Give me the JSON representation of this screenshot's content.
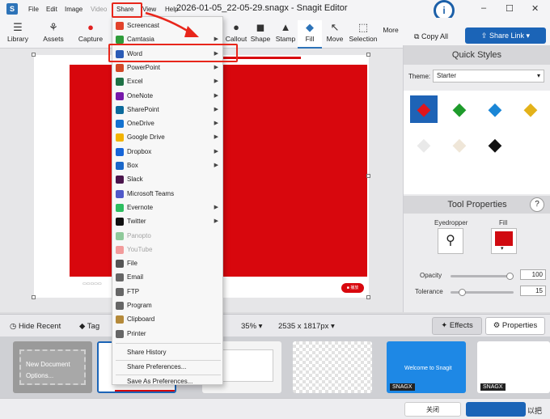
{
  "app": {
    "logo": "S",
    "window_title": "2026-01-05_22-05-29.snagx - Snagit Editor",
    "status_badge": "i"
  },
  "menu": {
    "file": "File",
    "edit": "Edit",
    "image": "Image",
    "video": "Video",
    "share": "Share",
    "view": "View",
    "help": "Help"
  },
  "window_controls": {
    "minimize": "–",
    "maximize": "☐",
    "close": "✕"
  },
  "toolbar": {
    "library": "Library",
    "assets": "Assets",
    "capture": "Capture",
    "callout": "Callout",
    "shape": "Shape",
    "stamp": "Stamp",
    "fill": "Fill",
    "move": "Move",
    "selection": "Selection",
    "more": "More",
    "copy_all": "Copy All",
    "share_link": "Share Link"
  },
  "share_menu": {
    "items": [
      {
        "label": "Screencast",
        "icon": "screencast-icon",
        "color": "#e2432b",
        "disabled": false,
        "submenu": false
      },
      {
        "label": "Camtasia",
        "icon": "camtasia-icon",
        "color": "#2f9c3a",
        "disabled": false,
        "submenu": true
      },
      {
        "label": "Word",
        "icon": "word-icon",
        "color": "#2b5cb6",
        "disabled": false,
        "submenu": true
      },
      {
        "label": "PowerPoint",
        "icon": "powerpoint-icon",
        "color": "#d24726",
        "disabled": false,
        "submenu": true
      },
      {
        "label": "Excel",
        "icon": "excel-icon",
        "color": "#1e7145",
        "disabled": false,
        "submenu": true
      },
      {
        "label": "OneNote",
        "icon": "onenote-icon",
        "color": "#7719aa",
        "disabled": false,
        "submenu": true
      },
      {
        "label": "SharePoint",
        "icon": "sharepoint-icon",
        "color": "#0b6a9b",
        "disabled": false,
        "submenu": true
      },
      {
        "label": "OneDrive",
        "icon": "onedrive-icon",
        "color": "#1472d0",
        "disabled": false,
        "submenu": true
      },
      {
        "label": "Google Drive",
        "icon": "google-drive-icon",
        "color": "#f2b300",
        "disabled": false,
        "submenu": true
      },
      {
        "label": "Dropbox",
        "icon": "dropbox-icon",
        "color": "#1665d8",
        "disabled": false,
        "submenu": true
      },
      {
        "label": "Box",
        "icon": "box-icon",
        "color": "#1b67c9",
        "disabled": false,
        "submenu": true
      },
      {
        "label": "Slack",
        "icon": "slack-icon",
        "color": "#4a154b",
        "disabled": false,
        "submenu": false
      },
      {
        "label": "Microsoft Teams",
        "icon": "teams-icon",
        "color": "#5059c9",
        "disabled": false,
        "submenu": false
      },
      {
        "label": "Evernote",
        "icon": "evernote-icon",
        "color": "#2dbe60",
        "disabled": false,
        "submenu": true
      },
      {
        "label": "Twitter",
        "icon": "twitter-icon",
        "color": "#111111",
        "disabled": false,
        "submenu": true
      },
      {
        "label": "Panopto",
        "icon": "panopto-icon",
        "color": "#8fc99a",
        "disabled": true,
        "submenu": false
      },
      {
        "label": "YouTube",
        "icon": "youtube-icon",
        "color": "#f29b9b",
        "disabled": true,
        "submenu": false
      },
      {
        "label": "File",
        "icon": "file-icon",
        "color": "#555555",
        "disabled": false,
        "submenu": false
      },
      {
        "label": "Email",
        "icon": "email-icon",
        "color": "#666666",
        "disabled": false,
        "submenu": false
      },
      {
        "label": "FTP",
        "icon": "ftp-icon",
        "color": "#666666",
        "disabled": false,
        "submenu": false
      },
      {
        "label": "Program",
        "icon": "program-icon",
        "color": "#666666",
        "disabled": false,
        "submenu": false
      },
      {
        "label": "Clipboard",
        "icon": "clipboard-icon",
        "color": "#b58a3a",
        "disabled": false,
        "submenu": false
      },
      {
        "label": "Printer",
        "icon": "printer-icon",
        "color": "#666666",
        "disabled": false,
        "submenu": false
      }
    ],
    "history": "Share History",
    "preferences": "Share Preferences...",
    "save_as_preferences": "Save As Preferences..."
  },
  "panel": {
    "quick_styles": "Quick Styles",
    "theme_label": "Theme:",
    "theme_value": "Starter",
    "tool_properties": "Tool Properties",
    "help": "?",
    "eyedropper": "Eyedropper",
    "fill": "Fill",
    "fill_color": "#d00a10",
    "opacity_label": "Opacity",
    "opacity_value": "100",
    "opacity_level": 1.0,
    "tolerance_label": "Tolerance",
    "tolerance_value": "15",
    "tolerance_level": 0.15,
    "swatch_colors": [
      "#e0151b",
      "#1e9b2b",
      "#1a86d6",
      "#e3b21a",
      "#e9e9e9",
      "#efe6d8",
      "#111111"
    ]
  },
  "bottom": {
    "hide_recent": "Hide Recent",
    "tag": "Tag",
    "zoom": "35%",
    "dimensions": "2535 x 1817px",
    "effects": "Effects",
    "properties": "Properties"
  },
  "tray": {
    "new_document": "New Document",
    "options": "Options...",
    "welcome": "Welcome to Snagit",
    "snagx_1": "SNAGX",
    "snagx_2": "SNAGX"
  },
  "canvas": {
    "chip_label": "■ 播放"
  },
  "footer": {
    "close": "关闭",
    "right_text": "以把"
  }
}
